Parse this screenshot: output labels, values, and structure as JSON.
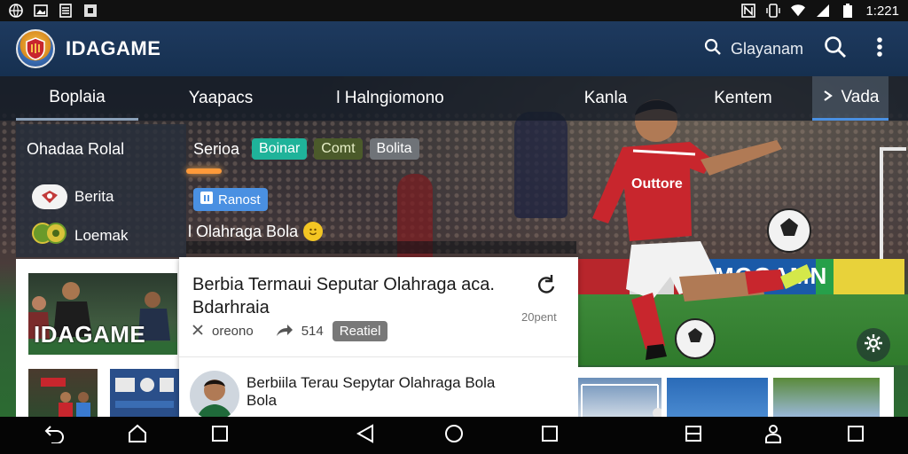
{
  "status_bar": {
    "time": "1:221",
    "left_icons": [
      "globe-icon",
      "gallery-icon",
      "document-icon",
      "square-icon"
    ],
    "right_icons": [
      "nfc-icon",
      "vibrate-icon",
      "wifi-icon",
      "signal-icon",
      "battery-icon"
    ]
  },
  "app_bar": {
    "brand": "IDAGAME",
    "search_label": "Glayanam"
  },
  "tabs": [
    {
      "label": "Boplaia"
    },
    {
      "label": "Yaapacs"
    },
    {
      "label": "l Halngiomono"
    },
    {
      "label": "Kanla"
    },
    {
      "label": "Kentem"
    },
    {
      "label": "Vada"
    }
  ],
  "side_panel": {
    "title": "Ohadaa Rolal",
    "items": [
      {
        "label": "Berita"
      },
      {
        "label": "Loemak"
      }
    ]
  },
  "filter_row": {
    "label": "Serioa",
    "chips": [
      "Boinar",
      "Comt",
      "Bolita"
    ]
  },
  "badge": {
    "label": "Ranost"
  },
  "subline": {
    "text": "l Olahraga Bola"
  },
  "hero": {
    "jersey_text": "Outtore",
    "ad_text": "MOGAMN"
  },
  "left_column": {
    "thumb_title": "IDAGAME"
  },
  "article": {
    "title_line1": "Berbia Termaui Seputar Olahraga aca.",
    "title_line2": "Bdarhraia",
    "time": "20pent",
    "meta_author": "oreono",
    "meta_count": "514",
    "button_label": "Reatiel",
    "sub_title": "Berbiila Terau Sepytar Olahraga Bola Bola"
  },
  "colors": {
    "app_bar": "#1e3a5f",
    "chip_teal": "#1fb39a",
    "chip_olive": "#4b5a2a",
    "badge_blue": "#4a90e2",
    "jersey_red": "#c8262d"
  }
}
